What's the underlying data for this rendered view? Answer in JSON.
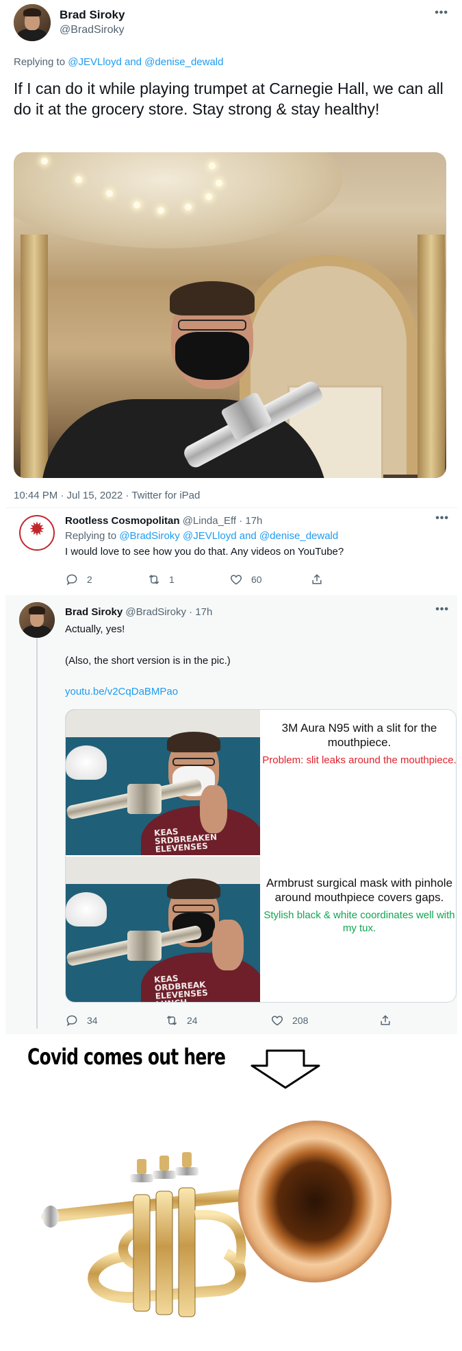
{
  "main_tweet": {
    "name": "Brad Siroky",
    "handle": "@BradSiroky",
    "more": "•••",
    "replying_prefix": "Replying to",
    "replying_to": "@JEVLloyd and @denise_dewald",
    "text": "If I can do it while playing trumpet at Carnegie Hall, we can all do it at the grocery store. Stay strong & stay healthy!",
    "meta": "10:44 PM · Jul 15, 2022 · Twitter for iPad"
  },
  "reply1": {
    "name": "Rootless Cosmopolitan",
    "handle_time": "@Linda_Eff · 17h",
    "more": "•••",
    "replying_prefix": "Replying to",
    "replying_to": "@BradSiroky @JEVLloyd and @denise_dewald",
    "text": "I would love to see how you do that. Any videos on YouTube?",
    "replies": "2",
    "retweets": "1",
    "likes": "60"
  },
  "reply2": {
    "name": "Brad Siroky",
    "handle_time": "@BradSiroky · 17h",
    "more": "•••",
    "text1": "Actually, yes!",
    "text2": "(Also, the short version is in the pic.)",
    "link": "youtu.be/v2CqDaBMPao",
    "card": {
      "top_caption": "3M Aura N95 with a slit for the mouthpiece.",
      "top_problem": "Problem: slit leaks around the mouthpiece.",
      "bottom_caption": "Armbrust surgical mask with pinhole around mouthpiece covers gaps.",
      "bottom_note": "Stylish black & white coordinates well with my tux.",
      "shirt_text_top": "KEAS SRDBREAKEN ELEVENSES",
      "shirt_text_bottom": "KEAS ORDBREAK ELEVENSES LUNCH"
    },
    "replies": "34",
    "retweets": "24",
    "likes": "208"
  },
  "meme": {
    "caption": "Covid comes out here"
  },
  "colors": {
    "link": "#1d9bf0",
    "secondary_text": "#536471",
    "problem_red": "#e0212b",
    "note_green": "#0fa650",
    "reply_bg": "#f7f9f9"
  },
  "icons": [
    "reply-icon",
    "retweet-icon",
    "like-icon",
    "share-icon",
    "more-icon",
    "down-arrow-icon"
  ]
}
